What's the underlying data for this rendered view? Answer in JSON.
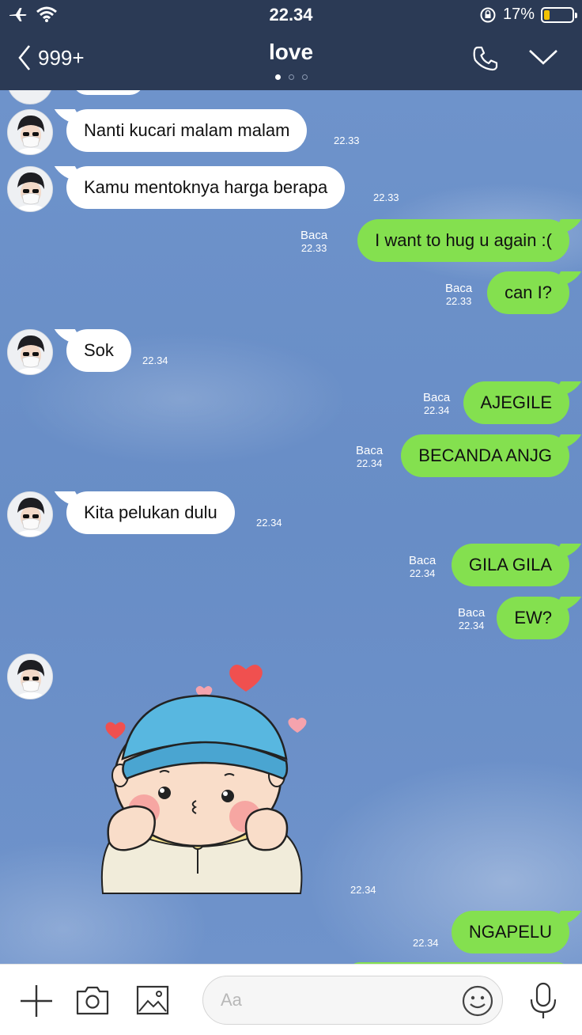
{
  "status_bar": {
    "time": "22.34",
    "battery": "17%"
  },
  "header": {
    "back_label": "999+",
    "title": "love",
    "page_dots": 3,
    "active_dot": 0
  },
  "messages": [
    {
      "side": "in",
      "text": "Nanti kucari malam malam",
      "time": "22.33"
    },
    {
      "side": "in",
      "text": "Kamu mentoknya harga berapa",
      "time": "22.33"
    },
    {
      "side": "out",
      "text": "I want to hug u again :(",
      "read": "Baca",
      "time": "22.33"
    },
    {
      "side": "out",
      "text": "can I?",
      "read": "Baca",
      "time": "22.33"
    },
    {
      "side": "in",
      "text": "Sok",
      "time": "22.34"
    },
    {
      "side": "out",
      "text": "AJEGILE",
      "read": "Baca",
      "time": "22.34"
    },
    {
      "side": "out",
      "text": "BECANDA ANJG",
      "read": "Baca",
      "time": "22.34"
    },
    {
      "side": "in",
      "text": "Kita pelukan dulu",
      "time": "22.34"
    },
    {
      "side": "out",
      "text": "GILA GILA",
      "read": "Baca",
      "time": "22.34"
    },
    {
      "side": "out",
      "text": "EW?",
      "read": "Baca",
      "time": "22.34"
    },
    {
      "side": "in",
      "sticker": "blushing-baby-sticker",
      "time": "22.34"
    },
    {
      "side": "out",
      "text": "NGAPELU",
      "time": "22.34"
    }
  ],
  "composer": {
    "placeholder": "Aa"
  },
  "colors": {
    "header_bg": "#2b3a55",
    "outgoing_bubble": "#84e04f",
    "incoming_bubble": "#ffffff",
    "chat_bg": "#6a8fc8",
    "battery_fill": "#f2c200"
  },
  "icons": [
    "airplane-icon",
    "wifi-icon",
    "orientation-lock-icon",
    "battery-icon",
    "back-chevron-icon",
    "phone-icon",
    "chevron-down-icon",
    "plus-icon",
    "camera-icon",
    "image-icon",
    "emoji-icon",
    "microphone-icon"
  ]
}
